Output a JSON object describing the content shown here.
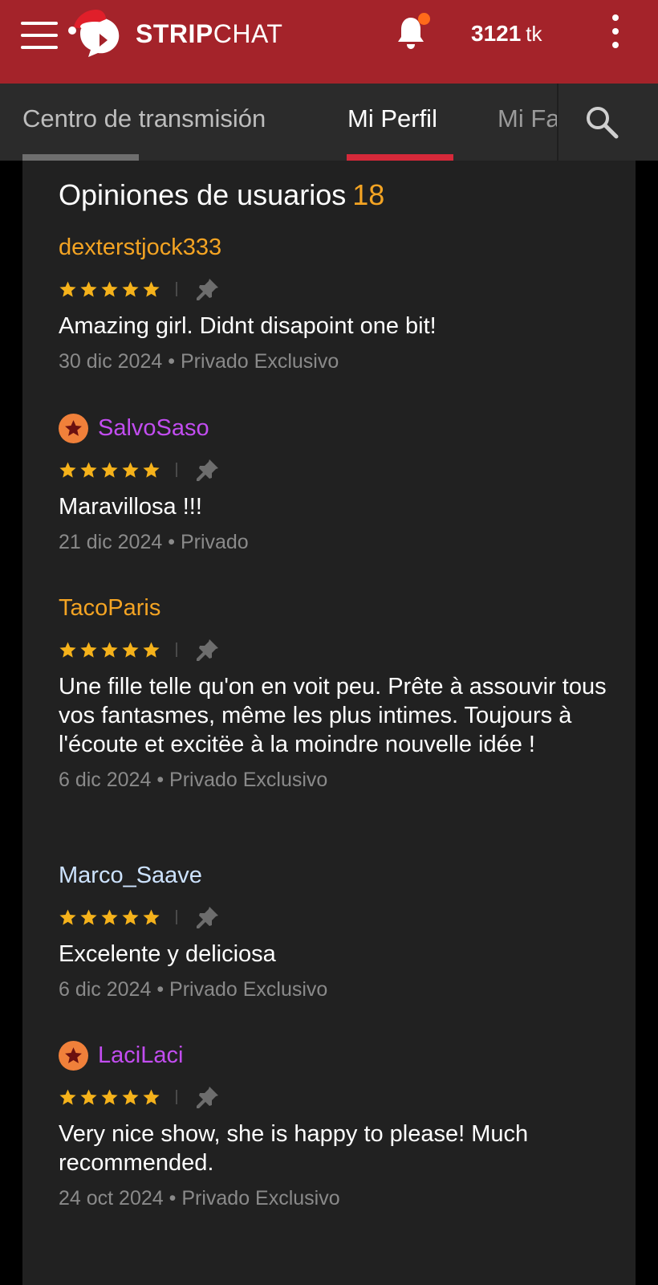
{
  "header": {
    "brand_bold": "STRIP",
    "brand_light": "CHAT",
    "tokens_value": "3121",
    "tokens_unit": "tk"
  },
  "tabs": [
    {
      "label": "Centro de transmisión",
      "state": "inactive"
    },
    {
      "label": "Mi Perfil",
      "state": "active"
    },
    {
      "label": "Mi Fa",
      "state": "partial"
    }
  ],
  "section": {
    "title": "Opiniones de usuarios",
    "count": "18"
  },
  "colors": {
    "topbar": "#a4232a",
    "tabbar": "#2b2b2b",
    "panel": "#212121",
    "accent_orange": "#f4a423",
    "active_tab_underline": "#d6293a",
    "star": "#f5b21b",
    "username_gold": "#f4a423",
    "username_purple": "#c24df0",
    "username_blue": "#cde3ff",
    "badge": "#f0803a"
  },
  "reviews": [
    {
      "author": "dexterstjock333",
      "author_color": "#f4a423",
      "has_badge": false,
      "rating": 5,
      "text": "Amazing girl. Didnt disapoint one bit!",
      "date": "30 dic 2024",
      "type": "Privado Exclusivo"
    },
    {
      "author": "SalvoSaso",
      "author_color": "#c24df0",
      "has_badge": true,
      "rating": 5,
      "text": "Maravillosa !!!",
      "date": "21 dic 2024",
      "type": "Privado"
    },
    {
      "author": "TacoParis",
      "author_color": "#f4a423",
      "has_badge": false,
      "rating": 5,
      "text": "Une fille telle qu'on en voit peu. Prête à assouvir tous vos fantasmes, même les plus intimes. Toujours à l'écoute et excitëe à la moindre nouvelle idée !",
      "date": "6 dic 2024",
      "type": "Privado Exclusivo"
    },
    {
      "author": "Marco_Saave",
      "author_color": "#cde3ff",
      "has_badge": false,
      "rating": 5,
      "text": "Excelente y deliciosa",
      "date": "6 dic 2024",
      "type": "Privado Exclusivo"
    },
    {
      "author": "LaciLaci",
      "author_color": "#c24df0",
      "has_badge": true,
      "rating": 5,
      "text": "Very nice show, she is happy to please! Much recommended.",
      "date": "24 oct 2024",
      "type": "Privado Exclusivo"
    }
  ]
}
